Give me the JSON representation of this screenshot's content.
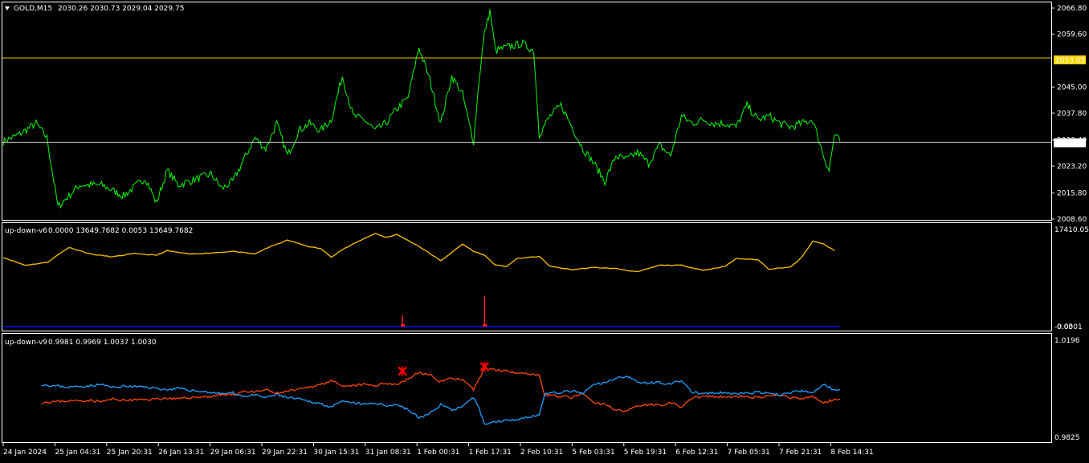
{
  "colors": {
    "background": "#000000",
    "frame": "#ffffff",
    "price_line": "#00ff00",
    "h_line": "#ffd700",
    "bid_line": "#c0c0c0",
    "osc_yellow": "#ffc000",
    "osc_red": "#ff2020",
    "osc_blue": "#0000ff",
    "v9_orange": "#ff4500",
    "v9_blue": "#1ea0ff",
    "marker_red": "#ff0000"
  },
  "chart_data": [
    {
      "type": "line",
      "title": "GOLD,M15",
      "ohlc_header": "2030.26 2030.73 2029.04 2029.75",
      "collapse_icon": "triangle-down-icon",
      "ylim": [
        2008.6,
        2066.8
      ],
      "y_ticks": [
        "2066.80",
        "2059.60",
        "2053.05",
        "2045.00",
        "2037.80",
        "2030.40",
        "2029.75",
        "2023.20",
        "2015.80",
        "2008.60"
      ],
      "y_tick_values": [
        2066.8,
        2059.6,
        2052.6,
        2045.0,
        2037.8,
        2030.4,
        2029.75,
        2023.2,
        2015.8,
        2008.6
      ],
      "hline_label": "2053.05",
      "hline_value": 2053.05,
      "bid_label": "2029.75",
      "bid_value": 2029.75,
      "anchors": [
        [
          0,
          2030
        ],
        [
          3,
          2032
        ],
        [
          6,
          2035
        ],
        [
          8,
          2031
        ],
        [
          10,
          2012
        ],
        [
          12,
          2015
        ],
        [
          14,
          2018
        ],
        [
          18,
          2018
        ],
        [
          22,
          2015
        ],
        [
          26,
          2020
        ],
        [
          28,
          2013
        ],
        [
          30,
          2022
        ],
        [
          32,
          2018
        ],
        [
          34,
          2019
        ],
        [
          38,
          2021
        ],
        [
          40,
          2017
        ],
        [
          42,
          2019
        ],
        [
          44,
          2025
        ],
        [
          46,
          2031
        ],
        [
          48,
          2028
        ],
        [
          50,
          2035
        ],
        [
          52,
          2026
        ],
        [
          54,
          2033
        ],
        [
          56,
          2035
        ],
        [
          58,
          2033
        ],
        [
          60,
          2036
        ],
        [
          62,
          2048
        ],
        [
          64,
          2037
        ],
        [
          66,
          2036
        ],
        [
          68,
          2033
        ],
        [
          70,
          2035
        ],
        [
          72,
          2039
        ],
        [
          74,
          2042
        ],
        [
          76,
          2056
        ],
        [
          78,
          2047
        ],
        [
          80,
          2035
        ],
        [
          82,
          2048
        ],
        [
          84,
          2043
        ],
        [
          85,
          2036
        ],
        [
          86,
          2030
        ],
        [
          87,
          2047
        ],
        [
          88,
          2060
        ],
        [
          89,
          2066
        ],
        [
          90,
          2055
        ],
        [
          92,
          2056
        ],
        [
          95,
          2057
        ],
        [
          97,
          2055
        ],
        [
          98,
          2032
        ],
        [
          100,
          2037
        ],
        [
          102,
          2040
        ],
        [
          104,
          2034
        ],
        [
          106,
          2028
        ],
        [
          108,
          2024
        ],
        [
          110,
          2019
        ],
        [
          112,
          2026
        ],
        [
          114,
          2025
        ],
        [
          116,
          2027
        ],
        [
          118,
          2024
        ],
        [
          120,
          2029
        ],
        [
          122,
          2026
        ],
        [
          124,
          2037
        ],
        [
          126,
          2035
        ],
        [
          128,
          2036
        ],
        [
          130,
          2035
        ],
        [
          132,
          2035
        ],
        [
          134,
          2034
        ],
        [
          136,
          2040
        ],
        [
          138,
          2036
        ],
        [
          140,
          2037
        ],
        [
          142,
          2035
        ],
        [
          144,
          2034
        ],
        [
          146,
          2035
        ],
        [
          148,
          2036
        ],
        [
          150,
          2026
        ],
        [
          151,
          2022
        ],
        [
          152,
          2032
        ],
        [
          153,
          2030
        ]
      ],
      "x_ticks": [
        "24 Jan 2024",
        "25 Jan 04:31",
        "25 Jan 20:31",
        "26 Jan 13:31",
        "29 Jan 06:31",
        "29 Jan 22:31",
        "30 Jan 15:31",
        "31 Jan 08:31",
        "1 Feb 00:31",
        "1 Feb 17:31",
        "2 Feb 10:31",
        "5 Feb 03:31",
        "5 Feb 19:31",
        "6 Feb 12:31",
        "7 Feb 05:31",
        "7 Feb 21:31",
        "8 Feb 14:31"
      ]
    },
    {
      "type": "line",
      "title": "up-down-v6",
      "values_header": "0.0000 13649.7682 0.0053 13649.7682",
      "ylim": [
        0.0501,
        17410.051
      ],
      "y_tick_top": "17410.051",
      "y_tick_bottom": "-0.0501",
      "y_tick_bottom_overlap": "0.00",
      "anchors": [
        [
          0,
          12400
        ],
        [
          4,
          11000
        ],
        [
          8,
          11500
        ],
        [
          12,
          14200
        ],
        [
          16,
          13000
        ],
        [
          20,
          12500
        ],
        [
          24,
          13100
        ],
        [
          28,
          12800
        ],
        [
          30,
          13600
        ],
        [
          34,
          13000
        ],
        [
          38,
          13200
        ],
        [
          42,
          13500
        ],
        [
          46,
          13000
        ],
        [
          48,
          14000
        ],
        [
          52,
          15500
        ],
        [
          56,
          14300
        ],
        [
          58,
          14000
        ],
        [
          60,
          12500
        ],
        [
          62,
          13800
        ],
        [
          64,
          14800
        ],
        [
          66,
          15800
        ],
        [
          68,
          16700
        ],
        [
          70,
          16000
        ],
        [
          72,
          16500
        ],
        [
          76,
          14400
        ],
        [
          80,
          11800
        ],
        [
          84,
          14800
        ],
        [
          86,
          13500
        ],
        [
          88,
          12800
        ],
        [
          90,
          11000
        ],
        [
          92,
          10800
        ],
        [
          94,
          12200
        ],
        [
          98,
          12600
        ],
        [
          100,
          10800
        ],
        [
          104,
          10200
        ],
        [
          108,
          10600
        ],
        [
          112,
          10400
        ],
        [
          116,
          9800
        ],
        [
          120,
          11000
        ],
        [
          124,
          11000
        ],
        [
          128,
          10100
        ],
        [
          132,
          10800
        ],
        [
          134,
          12200
        ],
        [
          138,
          12000
        ],
        [
          140,
          10300
        ],
        [
          144,
          10700
        ],
        [
          146,
          12400
        ],
        [
          148,
          15300
        ],
        [
          150,
          14800
        ],
        [
          152,
          13600
        ]
      ],
      "spikes": [
        [
          73,
          2000
        ],
        [
          88,
          5500
        ]
      ],
      "baseline": 0.0501
    },
    {
      "type": "line",
      "title": "up-down-v9",
      "values_header": "0.9981 0.9969 1.0037 1.0030",
      "ylim": [
        0.9825,
        1.0196
      ],
      "y_tick_top": "1.0196",
      "y_tick_bottom": "0.9825",
      "orange_anchors": [
        [
          7,
          0.9962
        ],
        [
          9,
          0.9965
        ],
        [
          12,
          0.9968
        ],
        [
          16,
          0.997
        ],
        [
          18,
          0.9965
        ],
        [
          20,
          0.9975
        ],
        [
          22,
          0.997
        ],
        [
          26,
          0.9973
        ],
        [
          30,
          0.9978
        ],
        [
          32,
          0.9975
        ],
        [
          34,
          0.998
        ],
        [
          36,
          0.9983
        ],
        [
          38,
          0.9985
        ],
        [
          40,
          0.9992
        ],
        [
          42,
          0.999
        ],
        [
          44,
          1.0005
        ],
        [
          46,
          1.0
        ],
        [
          48,
          1.001
        ],
        [
          50,
          0.9995
        ],
        [
          52,
          1.0005
        ],
        [
          54,
          1.001
        ],
        [
          56,
          1.002
        ],
        [
          58,
          1.003
        ],
        [
          60,
          1.0045
        ],
        [
          62,
          1.002
        ],
        [
          64,
          1.0025
        ],
        [
          66,
          1.003
        ],
        [
          68,
          1.0025
        ],
        [
          70,
          1.0035
        ],
        [
          72,
          1.003
        ],
        [
          74,
          1.005
        ],
        [
          76,
          1.0075
        ],
        [
          78,
          1.0065
        ],
        [
          80,
          1.004
        ],
        [
          82,
          1.0055
        ],
        [
          84,
          1.0045
        ],
        [
          86,
          1.001
        ],
        [
          87,
          1.005
        ],
        [
          88,
          1.009
        ],
        [
          90,
          1.0085
        ],
        [
          92,
          1.008
        ],
        [
          94,
          1.0075
        ],
        [
          98,
          1.0065
        ],
        [
          99,
          0.999
        ],
        [
          102,
          0.9985
        ],
        [
          104,
          0.998
        ],
        [
          106,
          0.9995
        ],
        [
          108,
          0.996
        ],
        [
          110,
          0.9955
        ],
        [
          112,
          0.9935
        ],
        [
          114,
          0.993
        ],
        [
          116,
          0.995
        ],
        [
          118,
          0.9955
        ],
        [
          120,
          0.9952
        ],
        [
          122,
          0.996
        ],
        [
          124,
          0.9945
        ],
        [
          126,
          0.998
        ],
        [
          128,
          0.9985
        ],
        [
          130,
          0.9983
        ],
        [
          132,
          0.9982
        ],
        [
          134,
          0.9985
        ],
        [
          136,
          0.9983
        ],
        [
          138,
          0.998
        ],
        [
          140,
          0.9985
        ],
        [
          142,
          0.999
        ],
        [
          144,
          0.998
        ],
        [
          146,
          0.9975
        ],
        [
          148,
          0.9985
        ],
        [
          150,
          0.996
        ],
        [
          152,
          0.9975
        ],
        [
          153,
          0.9974
        ]
      ],
      "blue_anchors": [
        [
          7,
          1.003
        ],
        [
          9,
          1.0025
        ],
        [
          12,
          1.002
        ],
        [
          16,
          1.0025
        ],
        [
          18,
          1.003
        ],
        [
          20,
          1.0018
        ],
        [
          22,
          1.0023
        ],
        [
          26,
          1.002
        ],
        [
          30,
          1.001
        ],
        [
          32,
          1.0015
        ],
        [
          34,
          1.0008
        ],
        [
          36,
          1.0004
        ],
        [
          38,
          1.0
        ],
        [
          40,
          0.9995
        ],
        [
          42,
          0.9998
        ],
        [
          44,
          0.9985
        ],
        [
          46,
          0.999
        ],
        [
          48,
          0.998
        ],
        [
          50,
          0.9992
        ],
        [
          52,
          0.998
        ],
        [
          54,
          0.9975
        ],
        [
          56,
          0.9965
        ],
        [
          58,
          0.9958
        ],
        [
          60,
          0.9945
        ],
        [
          62,
          0.9965
        ],
        [
          64,
          0.996
        ],
        [
          66,
          0.9955
        ],
        [
          68,
          0.996
        ],
        [
          70,
          0.995
        ],
        [
          72,
          0.9955
        ],
        [
          74,
          0.9935
        ],
        [
          76,
          0.9905
        ],
        [
          78,
          0.992
        ],
        [
          80,
          0.9955
        ],
        [
          82,
          0.9935
        ],
        [
          84,
          0.9945
        ],
        [
          86,
          0.998
        ],
        [
          87,
          0.994
        ],
        [
          88,
          0.988
        ],
        [
          90,
          0.989
        ],
        [
          92,
          0.9895
        ],
        [
          94,
          0.99
        ],
        [
          98,
          0.9915
        ],
        [
          99,
          0.9995
        ],
        [
          102,
          1.0
        ],
        [
          104,
          1.0005
        ],
        [
          106,
          0.9995
        ],
        [
          108,
          1.003
        ],
        [
          110,
          1.0035
        ],
        [
          112,
          1.0055
        ],
        [
          114,
          1.006
        ],
        [
          116,
          1.004
        ],
        [
          118,
          1.0035
        ],
        [
          120,
          1.0038
        ],
        [
          122,
          1.003
        ],
        [
          124,
          1.0045
        ],
        [
          126,
          1.0
        ],
        [
          128,
          0.9995
        ],
        [
          130,
          0.9997
        ],
        [
          132,
          0.9998
        ],
        [
          134,
          0.9995
        ],
        [
          136,
          0.9997
        ],
        [
          138,
          1.0
        ],
        [
          140,
          0.9995
        ],
        [
          142,
          0.999
        ],
        [
          144,
          1.0
        ],
        [
          146,
          1.0005
        ],
        [
          148,
          0.9998
        ],
        [
          150,
          1.003
        ],
        [
          152,
          1.001
        ],
        [
          153,
          1.001
        ]
      ],
      "markers": [
        [
          73,
          1.008
        ],
        [
          88,
          1.0097
        ]
      ]
    }
  ]
}
